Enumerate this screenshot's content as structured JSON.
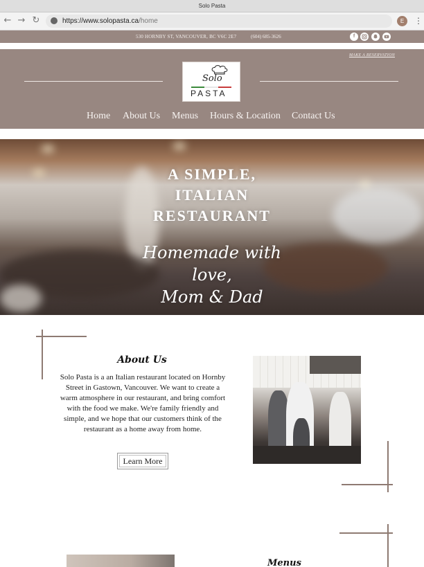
{
  "browser": {
    "window_title": "Solo Pasta",
    "url_domain": "https://www.solopasta.ca",
    "url_path": "/home",
    "profile_initial": "E"
  },
  "info_bar": {
    "address": "530 HORNBY ST, VANCOUVER, BC V6C 2E7",
    "phone": "(604) 685-3626",
    "social_icons": [
      "facebook-icon",
      "instagram-icon",
      "snapchat-icon",
      "youtube-icon"
    ]
  },
  "header": {
    "reservation_link": "MAKE A RESERVATION",
    "logo": {
      "script": "Solo",
      "wordmark": "PASTA"
    },
    "nav": [
      {
        "label": "Home"
      },
      {
        "label": "About Us"
      },
      {
        "label": "Menus"
      },
      {
        "label": "Hours & Location"
      },
      {
        "label": "Contact Us"
      }
    ]
  },
  "hero": {
    "title_line1": "A SIMPLE,",
    "title_line2": "ITALIAN",
    "title_line3": "RESTAURANT",
    "script_line1": "Homemade with love,",
    "script_line2": "Mom & Dad"
  },
  "about": {
    "title": "About Us",
    "body": "Solo Pasta is a an Italian restaurant located on Hornby Street in Gastown, Vancouver. We want to create a warm atmosphere in our restaurant, and bring comfort with the food we make. We're family friendly and simple, and we hope that our customers think of the restaurant as a home away from home.",
    "button_label": "Learn More"
  },
  "menus_section": {
    "title": "Menus"
  },
  "colors": {
    "brand_taupe": "#988781",
    "accent_line": "#8e7a72",
    "text_dark": "#222222"
  }
}
